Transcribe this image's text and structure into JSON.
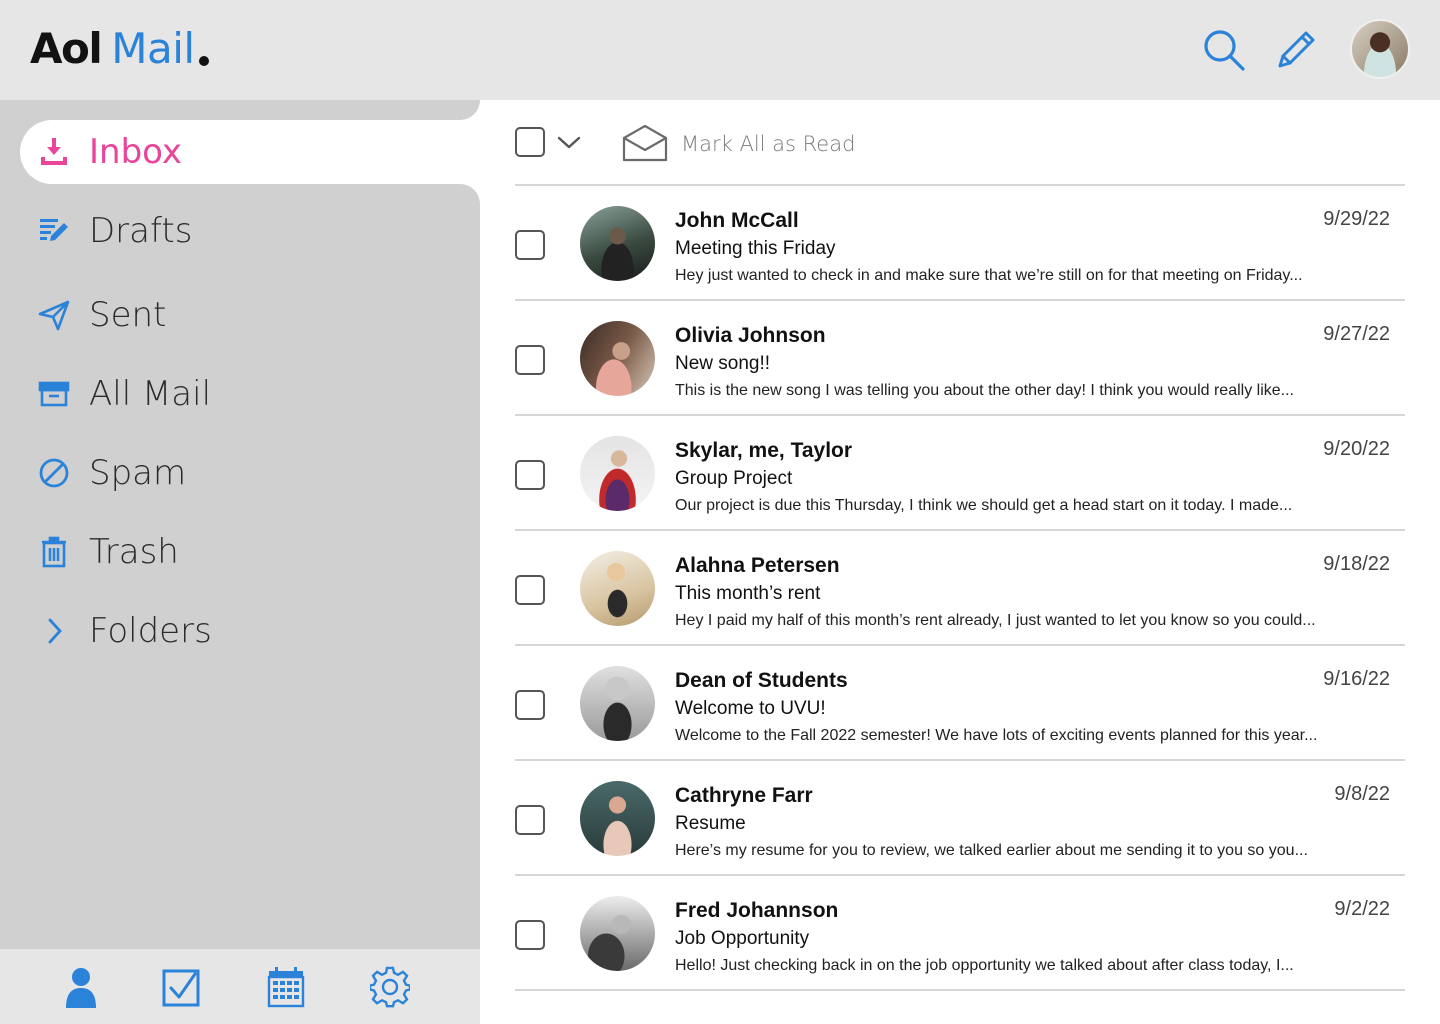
{
  "header": {
    "logo_aol": "Aol",
    "logo_mail": "Mail",
    "icons": [
      "search-icon",
      "compose-pencil-icon"
    ],
    "accent_color": "#2a83d8"
  },
  "sidebar": {
    "items": [
      {
        "label": "Inbox",
        "icon": "inbox-download-icon",
        "active": true,
        "color": "#e8459b"
      },
      {
        "label": "Drafts",
        "icon": "drafts-icon"
      },
      {
        "label": "Sent",
        "icon": "paper-plane-icon"
      },
      {
        "label": "All Mail",
        "icon": "archive-box-icon"
      },
      {
        "label": "Spam",
        "icon": "block-icon"
      },
      {
        "label": "Trash",
        "icon": "trash-icon"
      },
      {
        "label": "Folders",
        "icon": "chevron-right-icon"
      }
    ],
    "bottom_icons": [
      "contacts-icon",
      "tasks-icon",
      "calendar-icon",
      "settings-gear-icon"
    ]
  },
  "toolbar": {
    "mark_all_read": "Mark All as Read"
  },
  "emails": [
    {
      "sender": "John McCall",
      "date": "9/29/22",
      "subject": "Meeting this Friday",
      "preview": "Hey just wanted to check in and make sure that we’re still on for that meeting on Friday..."
    },
    {
      "sender": "Olivia Johnson",
      "date": "9/27/22",
      "subject": "New song!!",
      "preview": "This is the new song I was telling you about the other day! I think you would really like..."
    },
    {
      "sender": "Skylar, me, Taylor",
      "date": "9/20/22",
      "subject": "Group Project",
      "preview": "Our project is due this Thursday, I think we should get a head start on it today. I made..."
    },
    {
      "sender": "Alahna Petersen",
      "date": "9/18/22",
      "subject": "This month’s rent",
      "preview": "Hey I paid my half of this month’s rent already, I just wanted to let you know so you could..."
    },
    {
      "sender": "Dean of Students",
      "date": "9/16/22",
      "subject": "Welcome to UVU!",
      "preview": "Welcome to the Fall 2022 semester! We have lots of exciting events planned for this year..."
    },
    {
      "sender": "Cathryne Farr",
      "date": "9/8/22",
      "subject": "Resume",
      "preview": "Here’s my resume for you to review, we talked earlier about me sending it to you so you..."
    },
    {
      "sender": "Fred Johannson",
      "date": "9/2/22",
      "subject": "Job Opportunity",
      "preview": "Hello! Just checking back in on the job opportunity we talked about after class today, I..."
    }
  ]
}
